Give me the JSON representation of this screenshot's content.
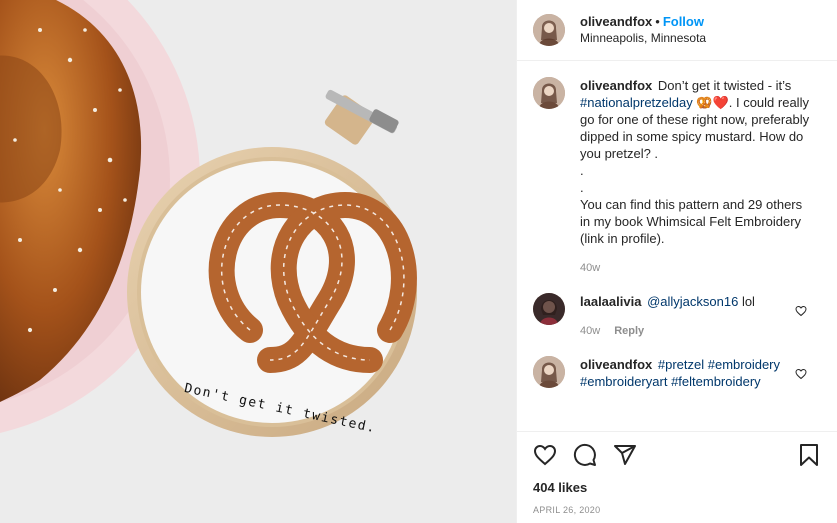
{
  "post": {
    "image_text": "Don't get it twisted."
  },
  "header": {
    "username": "oliveandfox",
    "separator": "•",
    "follow_label": "Follow",
    "location": "Minneapolis, Minnesota"
  },
  "caption": {
    "username": "oliveandfox",
    "text_start": "Don’t get it twisted - it’s ",
    "hashtag": "#nationalpretzelday",
    "emojis": "🥨❤️",
    "text_end": ". I could really go for one of these right now, preferably dipped in some spicy mustard. How do you pretzel? .",
    "dot1": ".",
    "dot2": ".",
    "text_more": "You can find this pattern and 29 others in my book Whimsical Felt Embroidery (link in profile).",
    "time": "40w"
  },
  "comments": [
    {
      "username": "laalaalivia",
      "mention": "@allyjackson16",
      "text": " lol",
      "time": "40w",
      "reply_label": "Reply"
    },
    {
      "username": "oliveandfox",
      "tags": [
        "#pretzel",
        "#embroidery",
        "#embroideryart",
        "#feltembroidery"
      ]
    }
  ],
  "actions": {
    "likes": "404 likes",
    "date": "APRIL 26, 2020"
  },
  "icons": [
    "heart-icon",
    "comment-icon",
    "share-icon",
    "bookmark-icon"
  ]
}
